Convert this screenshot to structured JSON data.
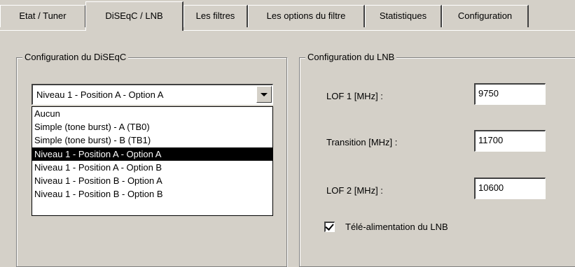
{
  "tabs": [
    {
      "label": "Etat / Tuner"
    },
    {
      "label": "DiSEqC / LNB"
    },
    {
      "label": "Les filtres"
    },
    {
      "label": "Les options du filtre"
    },
    {
      "label": "Statistiques"
    },
    {
      "label": "Configuration"
    }
  ],
  "active_tab": "DiSEqC / LNB",
  "diseqc": {
    "group_title": "Configuration du DiSEqC",
    "combo_value": "Niveau 1 - Position A - Option A",
    "options": [
      "Aucun",
      "Simple (tone burst) - A (TB0)",
      "Simple (tone burst) - B (TB1)",
      "Niveau 1 - Position A - Option A",
      "Niveau 1 - Position A - Option B",
      "Niveau 1 - Position B - Option A",
      "Niveau 1 - Position B - Option B"
    ],
    "selected_option": "Niveau 1 - Position A - Option A"
  },
  "lnb": {
    "group_title": "Configuration du LNB",
    "lof1_label": "LOF 1 [MHz] :",
    "lof1_value": "9750",
    "transition_label": "Transition [MHz] :",
    "transition_value": "11700",
    "lof2_label": "LOF 2 [MHz] :",
    "lof2_value": "10600",
    "power_label": "Télé-alimentation du LNB",
    "power_checked": true
  },
  "colors": {
    "face": "#d4d0c8",
    "highlight_bg": "#000000",
    "highlight_fg": "#ffffff"
  }
}
